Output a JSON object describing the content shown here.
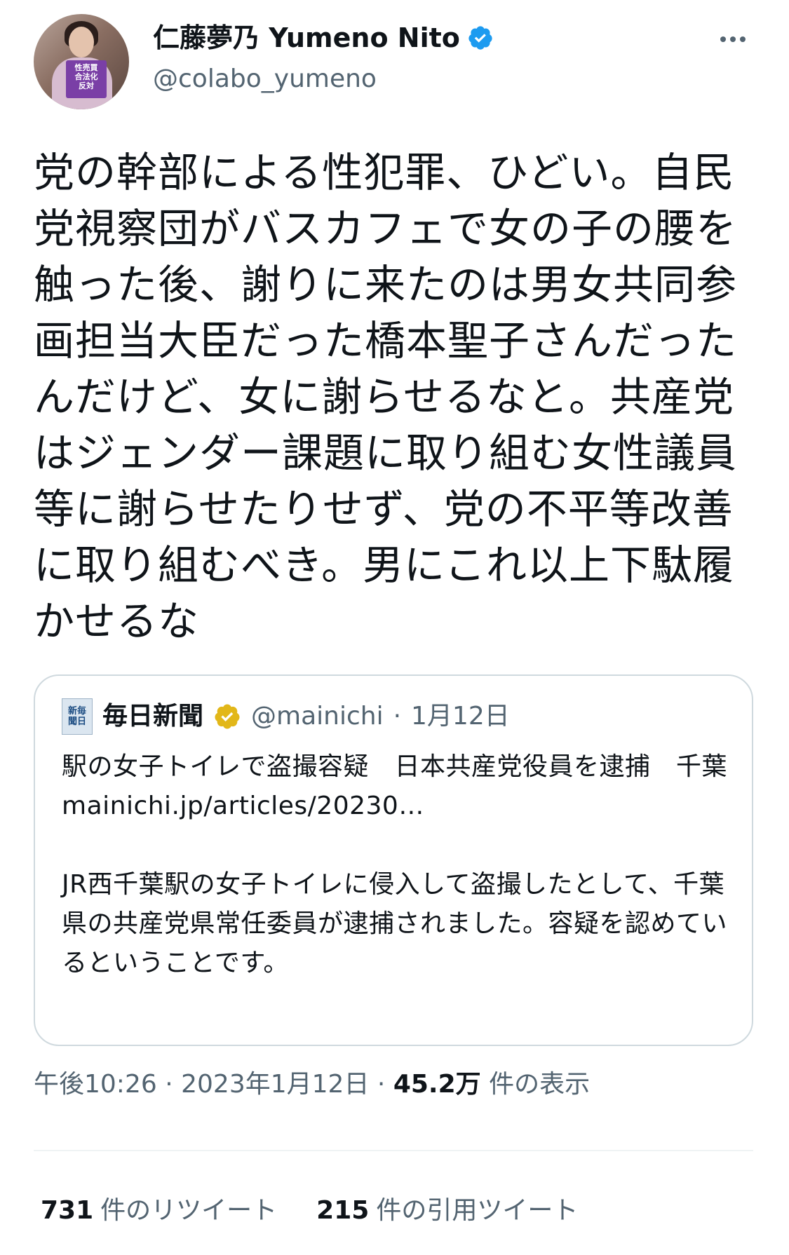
{
  "author": {
    "display_name": "仁藤夢乃 Yumeno Nito",
    "handle": "@colabo_yumeno",
    "verified": true,
    "avatar_sign_lines": [
      "性売買",
      "合法化",
      "反対"
    ]
  },
  "tweet": {
    "text": "党の幹部による性犯罪、ひどい。自民党視察団がバスカフェで女の子の腰を触った後、謝りに来たのは男女共同参画担当大臣だった橋本聖子さんだったんだけど、女に謝らせるなと。共産党はジェンダー課題に取り組む女性議員等に謝らせたりせず、党の不平等改善に取り組むべき。男にこれ以上下駄履かせるな"
  },
  "quote": {
    "logo_lines": [
      "新毎",
      "聞日"
    ],
    "name": "毎日新聞",
    "handle": "@mainichi",
    "separator": "·",
    "date": "1月12日",
    "title": "駅の女子トイレで盗撮容疑　日本共産党役員を逮捕　千葉",
    "link": "mainichi.jp/articles/20230…",
    "body": "JR西千葉駅の女子トイレに侵入して盗撮したとして、千葉県の共産党県常任委員が逮捕されました。容疑を認めているということです。"
  },
  "meta": {
    "time": "午後10:26",
    "sep1": "·",
    "date": "2023年1月12日",
    "sep2": "·",
    "views_count": "45.2万",
    "views_label": "件の表示"
  },
  "stats": {
    "retweets_count": "731",
    "retweets_label": "件のリツイート",
    "quotes_count": "215",
    "quotes_label": "件の引用ツイート"
  },
  "colors": {
    "verified_blue": "#1d9bf0",
    "verified_gold": "#e2b719",
    "secondary_text": "#536471",
    "border": "#cfd9de"
  }
}
